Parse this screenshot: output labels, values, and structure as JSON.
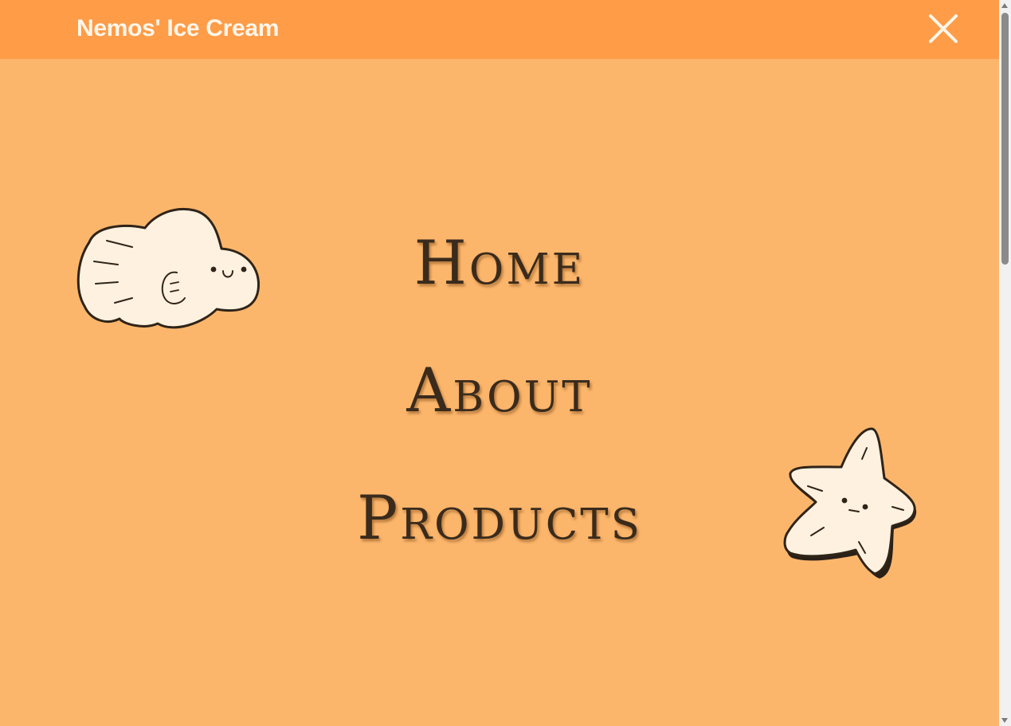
{
  "header": {
    "brand": "Nemos' Ice Cream",
    "close_icon": "close-icon"
  },
  "menu": {
    "items": [
      {
        "label": "Home"
      },
      {
        "label": "About"
      },
      {
        "label": "Products"
      }
    ]
  },
  "decorations": {
    "fish_icon": "fish-illustration",
    "star_icon": "starfish-illustration"
  },
  "colors": {
    "header_bg": "#fe9c48",
    "page_bg": "#fcb66c",
    "brand_text": "#fff6ea",
    "menu_text": "#3a2b1c",
    "illustration_fill": "#fff1e0"
  }
}
